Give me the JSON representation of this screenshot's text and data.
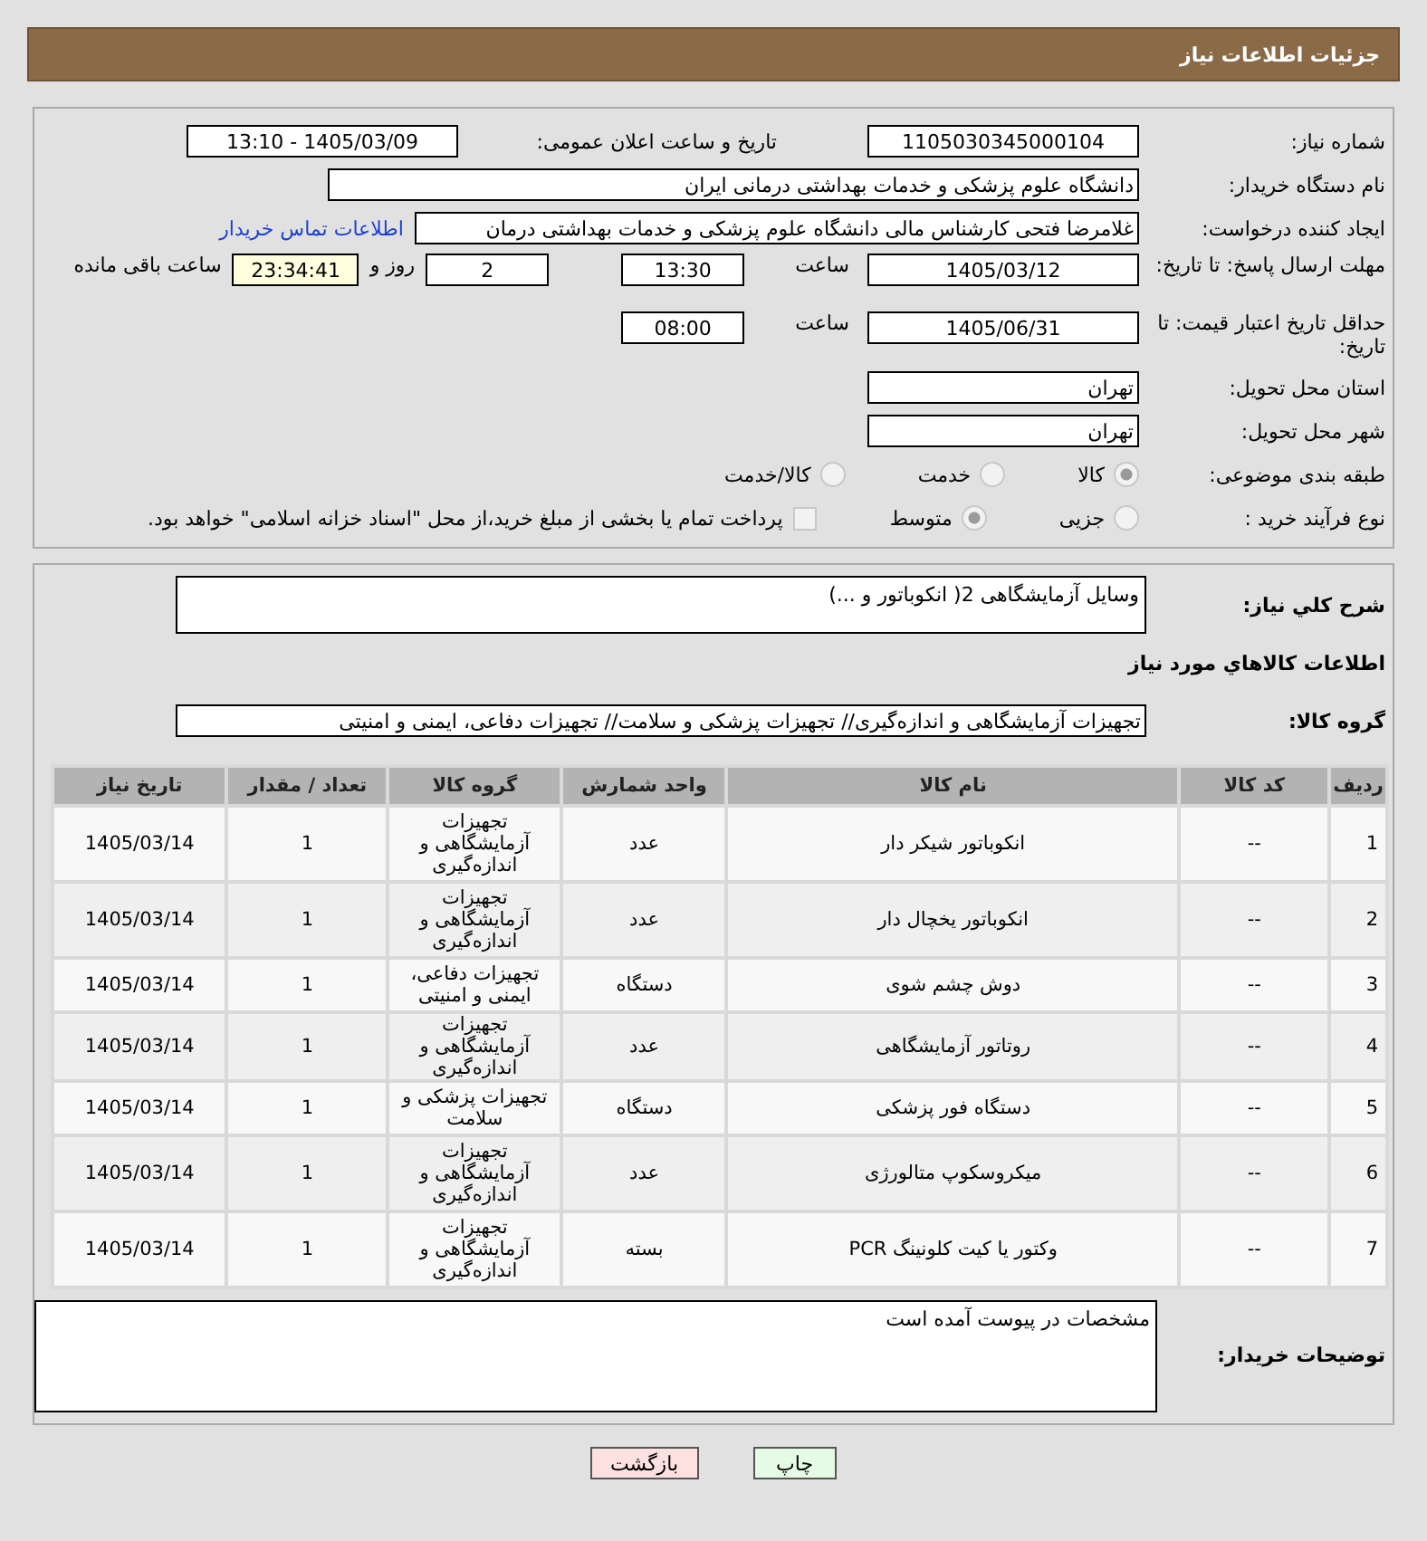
{
  "header": {
    "title": "جزئیات اطلاعات نیاز"
  },
  "form": {
    "need_number": {
      "label": "شماره نیاز:",
      "value": "1105030345000104"
    },
    "announce": {
      "label": "تاریخ و ساعت اعلان عمومی:",
      "value": "1405/03/09 - 13:10"
    },
    "buyer_org": {
      "label": "نام دستگاه خریدار:",
      "value": "دانشگاه علوم پزشکی و خدمات بهداشتی درمانی ایران"
    },
    "creator": {
      "label": "ایجاد کننده درخواست:",
      "value": "غلامرضا فتحی کارشناس مالی دانشگاه علوم پزشکی و خدمات بهداشتی درمان",
      "link": "اطلاعات تماس خریدار"
    },
    "reply_deadline": {
      "label": "مهلت ارسال پاسخ: تا تاریخ:",
      "date": "1405/03/12",
      "time_label": "ساعت",
      "time": "13:30",
      "days": "2",
      "days_label": "روز و",
      "remaining": "23:34:41",
      "remaining_label": "ساعت باقی مانده"
    },
    "price_validity": {
      "label": "حداقل تاریخ اعتبار قیمت: تا تاریخ:",
      "date": "1405/06/31",
      "time_label": "ساعت",
      "time": "08:00"
    },
    "province": {
      "label": "استان محل تحویل:",
      "value": "تهران"
    },
    "city": {
      "label": "شهر محل تحویل:",
      "value": "تهران"
    },
    "category": {
      "label": "طبقه بندی موضوعی:",
      "options": [
        {
          "label": "کالا",
          "selected": true
        },
        {
          "label": "خدمت",
          "selected": false
        },
        {
          "label": "کالا/خدمت",
          "selected": false
        }
      ]
    },
    "process": {
      "label": "نوع فرآیند خرید :",
      "options": [
        {
          "label": "جزیی",
          "selected": false
        },
        {
          "label": "متوسط",
          "selected": true
        }
      ],
      "payment": {
        "label": "پرداخت تمام یا بخشی از مبلغ خرید،از محل \"اسناد خزانه اسلامی\" خواهد بود.",
        "checked": false
      }
    }
  },
  "description": {
    "label": "شرح کلي نياز:",
    "value": "وسایل آزمایشگاهی 2( انکوباتور و ...)"
  },
  "goods_title": "اطلاعات کالاهاي مورد نياز",
  "goods_group": {
    "label": "گروه کالا:",
    "value": "تجهیزات آزمایشگاهی و اندازه‌گیری// تجهیزات پزشکی و سلامت// تجهیزات دفاعی، ایمنی و امنیتی"
  },
  "table": {
    "columns": [
      "ردیف",
      "کد کالا",
      "نام کالا",
      "واحد شمارش",
      "گروه کالا",
      "تعداد / مقدار",
      "تاریخ نیاز"
    ],
    "rows": [
      [
        "1",
        "--",
        "انکوباتور شیکر دار",
        "عدد",
        "تجهیزات آزمایشگاهی و اندازه‌گیری",
        "1",
        "1405/03/14"
      ],
      [
        "2",
        "--",
        "انکوباتور یخچال دار",
        "عدد",
        "تجهیزات آزمایشگاهی و اندازه‌گیری",
        "1",
        "1405/03/14"
      ],
      [
        "3",
        "--",
        "دوش چشم شوی",
        "دستگاه",
        "تجهیزات دفاعی، ایمنی و امنیتی",
        "1",
        "1405/03/14"
      ],
      [
        "4",
        "--",
        "روتاتور آزمایشگاهی",
        "عدد",
        "تجهیزات آزمایشگاهی و اندازه‌گیری",
        "1",
        "1405/03/14"
      ],
      [
        "5",
        "--",
        "دستگاه فور پزشکی",
        "دستگاه",
        "تجهیزات پزشکی و سلامت",
        "1",
        "1405/03/14"
      ],
      [
        "6",
        "--",
        "میکروسکوپ متالورژی",
        "عدد",
        "تجهیزات آزمایشگاهی و اندازه‌گیری",
        "1",
        "1405/03/14"
      ],
      [
        "7",
        "--",
        "وکتور یا کیت کلونینگ PCR",
        "بسته",
        "تجهیزات آزمایشگاهی و اندازه‌گیری",
        "1",
        "1405/03/14"
      ]
    ]
  },
  "buyer_notes": {
    "label": "توضیحات خریدار:",
    "value": "مشخصات در پیوست آمده است"
  },
  "buttons": [
    {
      "label": "چاپ",
      "kind": "print"
    },
    {
      "label": "بازگشت",
      "kind": "back"
    }
  ]
}
